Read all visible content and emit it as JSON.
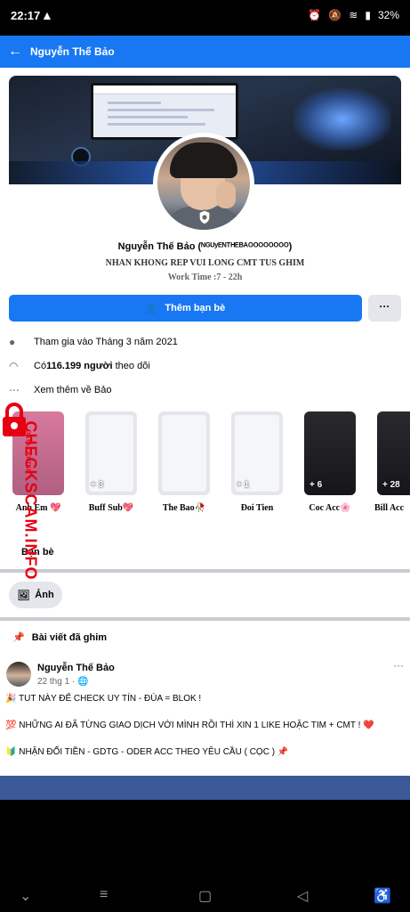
{
  "status_bar": {
    "time": "22:17",
    "battery": "32%"
  },
  "app_bar": {
    "back_icon": "arrow-left-icon",
    "title": "Nguyễn Thế Bảo"
  },
  "profile": {
    "name": "Nguyễn Thế Bảo (ᴺᴳᵁʸᴱᴺᵀᴴᴱᴮᴬᴼᴼᴼᴼᴼᴼᴼᴼ)",
    "bio": "NHAN KHONG REP VUI LONG CMT TUS GHIM",
    "work_time": "Work Time :7 - 22h",
    "add_friend_label": "Thêm bạn bè",
    "more_label": "···"
  },
  "info": {
    "joined": "Tham gia vào Tháng 3 năm 2021",
    "followers_prefix": "Có ",
    "followers_count": "116.199 người",
    "followers_suffix": " theo dõi",
    "see_more": "Xem thêm về Bảo"
  },
  "highlights": [
    {
      "label": "Anh Em 💖",
      "count": ""
    },
    {
      "label": "Buff Sub💖",
      "count": "+ 3"
    },
    {
      "label": "The Bao🥀",
      "count": ""
    },
    {
      "label": "Đoi Tien",
      "count": "+ 1"
    },
    {
      "label": "Coc Acc🌸",
      "count": "+ 6"
    },
    {
      "label": "Bill Acc",
      "count": "+ 28"
    }
  ],
  "friends_label": "Bạn bè",
  "photos_label": "Ảnh",
  "pinned_label": "Bài viết đã ghim",
  "post": {
    "author": "Nguyễn Thế Bảo",
    "meta": "22 thg 1 ·",
    "more": "···",
    "lines": [
      "🎉 TUT NÀY ĐỂ CHECK UY TÍN - ĐÙA = BLOK !",
      "💯 NHỮNG  AI ĐÃ TỪNG GIAO DỊCH VỚI MÌNH RỒI THÌ XIN 1 LIKE HOẶC TIM + CMT ! ❤️",
      "🔰 NHẬN ĐỔI TIỀN - GDTG - ODER ACC THEO YÊU CẦU ( CỌC ) 📌"
    ]
  },
  "watermark": {
    "brand": "CHECKSCAM.INFO",
    "sub": "DATA CENTER"
  },
  "colors": {
    "primary": "#1877f2",
    "watermark": "#e60012",
    "nav_strip": "#3b5998"
  }
}
